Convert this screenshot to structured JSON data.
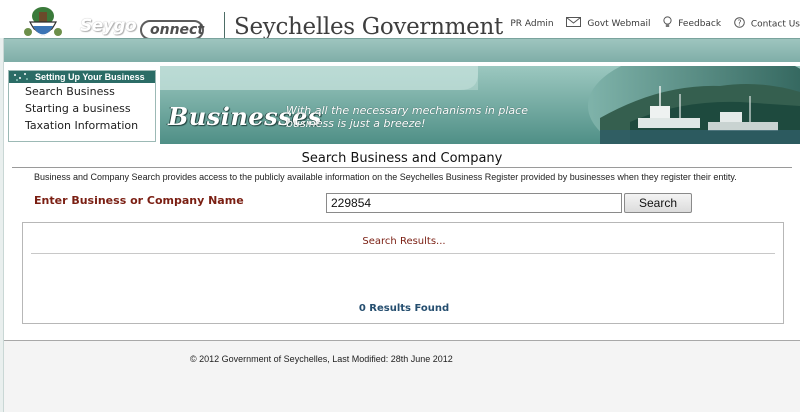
{
  "header": {
    "logo_text_left": "Seygo",
    "logo_text_right": "onnect",
    "site_title": "Seychelles Government",
    "links": [
      {
        "label": "PR Admin",
        "icon": "none"
      },
      {
        "label": "Govt Webmail",
        "icon": "envelope-icon"
      },
      {
        "label": "Feedback",
        "icon": "lightbulb-icon"
      },
      {
        "label": "Contact Us",
        "icon": "question-icon"
      }
    ]
  },
  "sidebar": {
    "heading": "Setting Up Your Business",
    "items": [
      {
        "label": "Search Business"
      },
      {
        "label": "Starting a business"
      },
      {
        "label": "Taxation Information"
      }
    ]
  },
  "banner": {
    "title": "Businesses",
    "tagline_line1": "With all the necessary mechanisms in place",
    "tagline_line2": "business is just a breeze!"
  },
  "search": {
    "heading": "Search Business and Company",
    "intro": "Business and Company Search provides access to the publicly available information on the Seychelles Business Register provided by businesses when they register their entity.",
    "field_label": "Enter Business or Company Name",
    "input_value": "229854",
    "button_label": "Search"
  },
  "results": {
    "title": "Search Results...",
    "count_text": "0 Results Found"
  },
  "footer": {
    "copyright": "© 2012 Government of Seychelles, Last Modified: 28th June 2012"
  },
  "colors": {
    "teal_band": "#8fb9b3",
    "nav_heading": "#2b6c66",
    "label_maroon": "#7a1e12",
    "results_count_blue": "#254e6f"
  }
}
